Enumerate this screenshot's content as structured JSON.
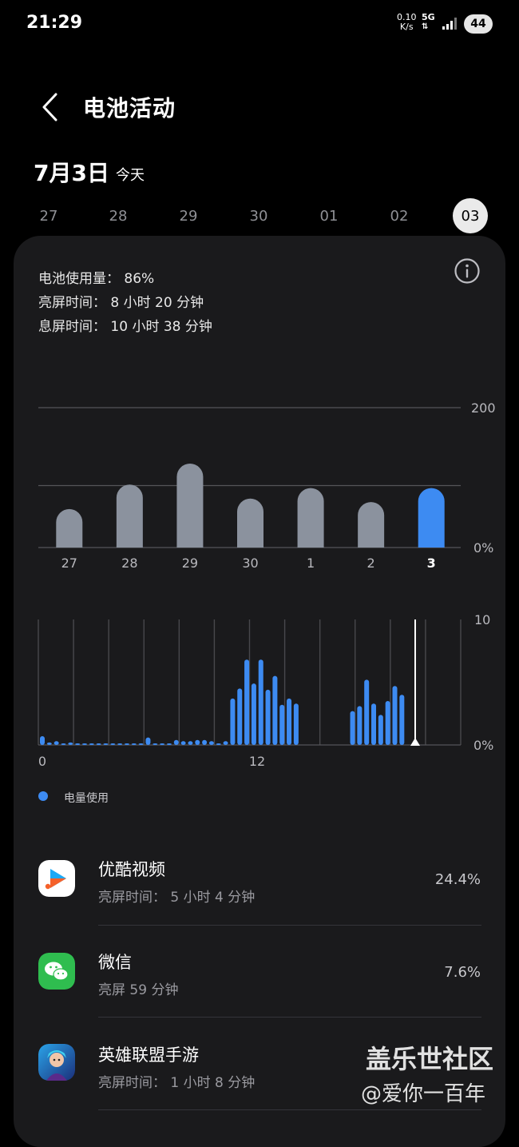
{
  "status_bar": {
    "time": "21:29",
    "net_speed_value": "0.10",
    "net_speed_unit": "K/s",
    "network_type": "5G",
    "battery_level": "44"
  },
  "header": {
    "title": "电池活动"
  },
  "date_header": {
    "date": "7月3日",
    "relative": "今天"
  },
  "date_strip": {
    "dates": [
      "27",
      "28",
      "29",
      "30",
      "01",
      "02"
    ],
    "selected": "03"
  },
  "summary": {
    "battery_usage": "电池使用量： 86%",
    "screen_on": "亮屏时间： 8 小时 20 分钟",
    "screen_off": "息屏时间： 10 小时 38 分钟"
  },
  "chart_data": [
    {
      "type": "bar",
      "categories": [
        "27",
        "28",
        "29",
        "30",
        "1",
        "2",
        "3"
      ],
      "values": [
        55,
        90,
        120,
        70,
        85,
        65,
        85
      ],
      "highlight_index": 6,
      "ylim": [
        0,
        200
      ],
      "y_tick_labels": [
        "0%",
        "200"
      ],
      "colors": {
        "bar": "#8b929e",
        "highlight": "#3d8bf2",
        "grid": "#555558"
      }
    },
    {
      "type": "bar",
      "x_tick_labels": [
        "0",
        "12"
      ],
      "y_tick_labels": [
        "0%",
        "10"
      ],
      "ylim": [
        0,
        10
      ],
      "values": [
        0.7,
        0.2,
        0.3,
        0.1,
        0.2,
        0.1,
        0.1,
        0.1,
        0.1,
        0.1,
        0.1,
        0.1,
        0.1,
        0.1,
        0.1,
        0.6,
        0.1,
        0.1,
        0.1,
        0.4,
        0.3,
        0.3,
        0.4,
        0.4,
        0.3,
        0.1,
        0.3,
        3.7,
        4.5,
        6.8,
        4.9,
        6.8,
        4.4,
        5.5,
        3.2,
        3.7,
        3.3,
        0,
        0,
        0,
        0,
        0,
        0,
        0,
        2.7,
        3.1,
        5.2,
        3.3,
        2.4,
        3.5,
        4.7,
        4.0
      ],
      "colors": {
        "bar": "#3d8bf2",
        "grid": "#555558"
      },
      "legend": [
        "电量使用"
      ]
    }
  ],
  "apps": [
    {
      "name": "优酷视频",
      "detail": "亮屏时间： 5 小时 4 分钟",
      "percent": "24.4%",
      "icon": "youku-icon"
    },
    {
      "name": "微信",
      "detail": "亮屏 59 分钟",
      "percent": "7.6%",
      "icon": "wechat-icon"
    },
    {
      "name": "英雄联盟手游",
      "detail": "亮屏时间： 1 小时 8 分钟",
      "percent": "",
      "icon": "lol-wild-rift-icon"
    }
  ],
  "watermark": {
    "line1": "盖乐世社区",
    "line2": "@爱你一百年"
  }
}
